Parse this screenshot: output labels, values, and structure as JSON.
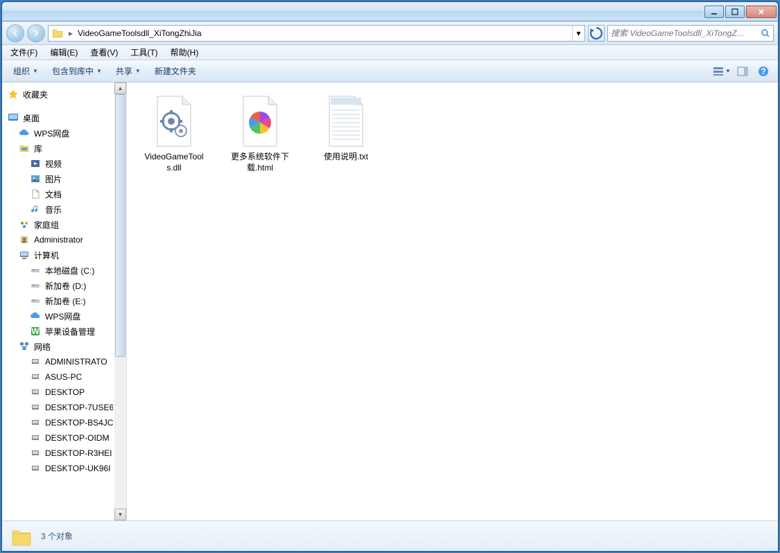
{
  "titlebar": {},
  "nav": {
    "path_segment": "VideoGameToolsdll_XiTongZhiJia",
    "search_placeholder": "搜索 VideoGameToolsdll_XiTongZ..."
  },
  "menubar": {
    "items": [
      {
        "label": "文件(F)"
      },
      {
        "label": "编辑(E)"
      },
      {
        "label": "查看(V)"
      },
      {
        "label": "工具(T)"
      },
      {
        "label": "帮助(H)"
      }
    ]
  },
  "toolbar": {
    "organize": "组织",
    "include": "包含到库中",
    "share": "共享",
    "newfolder": "新建文件夹"
  },
  "sidebar": {
    "favorites": "收藏夹",
    "desktop": "桌面",
    "desktop_items": [
      {
        "label": "WPS网盘",
        "icon": "cloud"
      },
      {
        "label": "库",
        "icon": "library"
      }
    ],
    "library_items": [
      {
        "label": "视频",
        "icon": "video"
      },
      {
        "label": "图片",
        "icon": "picture"
      },
      {
        "label": "文档",
        "icon": "document"
      },
      {
        "label": "音乐",
        "icon": "music"
      }
    ],
    "homegroup": "家庭组",
    "admin": "Administrator",
    "computer": "计算机",
    "drives": [
      {
        "label": "本地磁盘 (C:)"
      },
      {
        "label": "新加卷 (D:)"
      },
      {
        "label": "新加卷 (E:)"
      },
      {
        "label": "WPS网盘",
        "icon": "cloud"
      },
      {
        "label": "苹果设备管理",
        "icon": "apple"
      }
    ],
    "network": "网络",
    "network_items": [
      {
        "label": "ADMINISTRATO"
      },
      {
        "label": "ASUS-PC"
      },
      {
        "label": "DESKTOP"
      },
      {
        "label": "DESKTOP-7USE6"
      },
      {
        "label": "DESKTOP-BS4JC"
      },
      {
        "label": "DESKTOP-OIDM"
      },
      {
        "label": "DESKTOP-R3HEI"
      },
      {
        "label": "DESKTOP-UK96I"
      }
    ]
  },
  "files": [
    {
      "name": "VideoGameTools.dll",
      "type": "dll"
    },
    {
      "name": "更多系统软件下载.html",
      "type": "html"
    },
    {
      "name": "使用说明.txt",
      "type": "txt"
    }
  ],
  "status": {
    "text": "3 个对象"
  }
}
